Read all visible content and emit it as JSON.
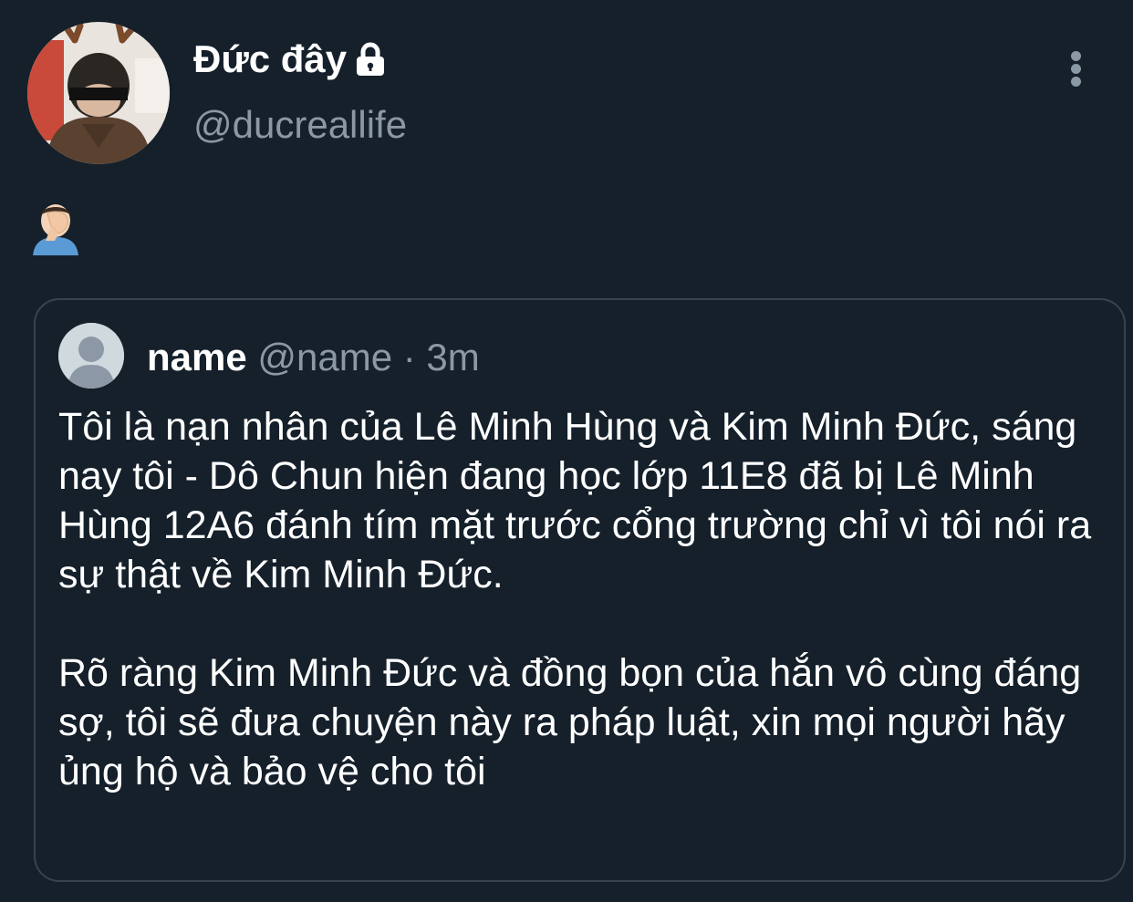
{
  "tweet": {
    "display_name": "Đức đây",
    "handle": "@ducreallife",
    "body_emoji": "🤦🏻‍♂️",
    "icons": {
      "verified_lock": "lock-icon",
      "more": "more-options-icon",
      "avatar": "avatar-photo"
    }
  },
  "quote": {
    "name": "name",
    "handle": "@name",
    "separator": " · ",
    "time": "3m",
    "paragraphs": [
      "Tôi là nạn nhân của Lê Minh Hùng và Kim Minh Đức, sáng nay tôi - Dô Chun hiện đang học lớp 11E8 đã bị Lê Minh Hùng 12A6 đánh tím mặt trước cổng trường chỉ vì tôi nói ra sự thật về Kim Minh Đức.",
      "Rõ ràng Kim Minh Đức và đồng bọn của hắn vô cùng đáng sợ, tôi sẽ đưa chuyện này ra pháp luật, xin mọi người hãy ủng hộ và bảo vệ cho tôi"
    ]
  },
  "colors": {
    "background": "#15202b",
    "text_primary": "#ffffff",
    "text_secondary": "#8b98a5",
    "border": "#38444d"
  }
}
